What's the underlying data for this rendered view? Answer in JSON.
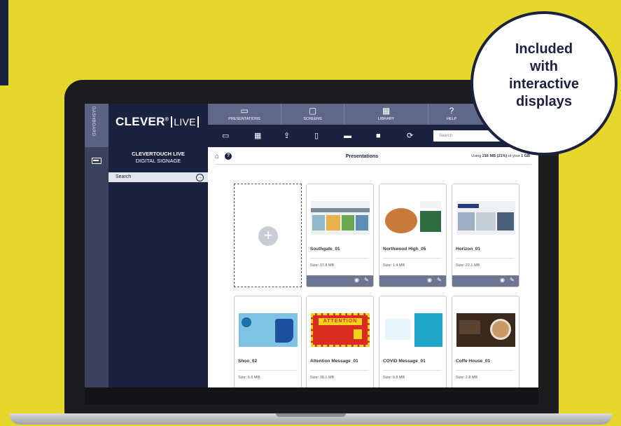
{
  "app": {
    "logo_main": "CLEVER",
    "logo_mark": "®",
    "logo_live": "LIVE",
    "rail_label": "DASHBOARD",
    "sidebar_title_1": "CLEVERTOUCH LIVE",
    "sidebar_title_2": "DIGITAL SIGNAGE",
    "sidebar_search": "Search"
  },
  "nav": {
    "tabs": [
      {
        "label": "PRESENTATIONS",
        "icon": "presentations-icon"
      },
      {
        "label": "SCREENS",
        "icon": "screen-icon"
      },
      {
        "label": "LIBRARY",
        "icon": "library-icon"
      },
      {
        "label": "HELP",
        "icon": "help-icon"
      }
    ],
    "search_placeholder": "Search"
  },
  "content": {
    "title": "Presentations",
    "usage_prefix": "Using ",
    "usage_amount": "216 MB (21%)",
    "usage_mid": " of your ",
    "usage_total": "1 GB"
  },
  "cards": [
    {
      "name": "Southgate_01",
      "size": "Size: 37.8 MB"
    },
    {
      "name": "Northwood High_05",
      "size": "Size: 1.4 MB"
    },
    {
      "name": "Horizon_01",
      "size": "Size: 22.1 MB"
    },
    {
      "name": "Shoo_02",
      "size": "Size: 5.6 MB"
    },
    {
      "name": "Attention Message_01",
      "size": "Size: 38.1 MB"
    },
    {
      "name": "COVID Message_01",
      "size": "Size: 9.8 MB"
    },
    {
      "name": "Coffe House_01",
      "size": "Size: 2.8 MB"
    }
  ],
  "thumb_text": {
    "attention": "ATTENTION"
  },
  "bubble": {
    "line1": "Included",
    "line2": "with",
    "line3": "interactive",
    "line4": "displays"
  },
  "colors": {
    "background": "#e6d72c",
    "navy": "#1b2240",
    "nav_slate": "#5f6888"
  }
}
